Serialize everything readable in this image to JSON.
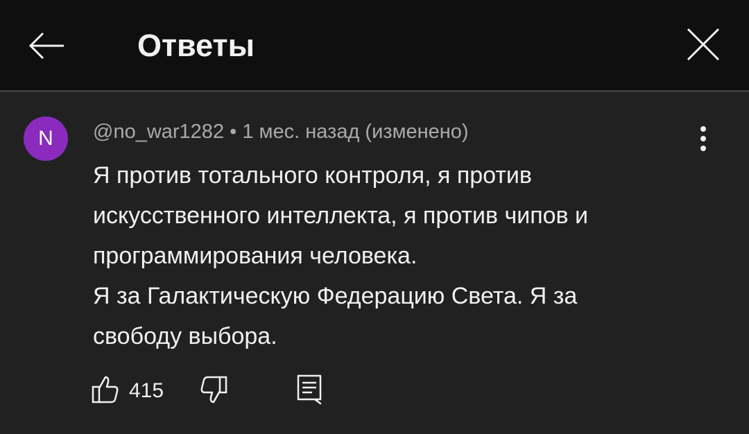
{
  "header": {
    "title": "Ответы",
    "back_icon": "arrow-left-icon",
    "close_icon": "close-icon"
  },
  "comment": {
    "avatar_letter": "N",
    "avatar_color": "#8a2bbd",
    "meta": "@no_war1282 • 1 мес. назад (изменено)",
    "lines": [
      "Я против тотального контроля, я против",
      "искусственного интеллекта, я против чипов и",
      "программирования человека.",
      "Я за Галактическую Федерацию Света. Я за",
      "свободу выбора."
    ],
    "like_count": "415",
    "icons": {
      "like": "thumbs-up-icon",
      "dislike": "thumbs-down-icon",
      "reply": "comment-icon",
      "more": "more-vertical-icon"
    }
  },
  "colors": {
    "header_bg": "#0f0f0f",
    "content_bg": "#212121",
    "text_primary": "#f1f1f1",
    "text_secondary": "#aaaaaa"
  }
}
